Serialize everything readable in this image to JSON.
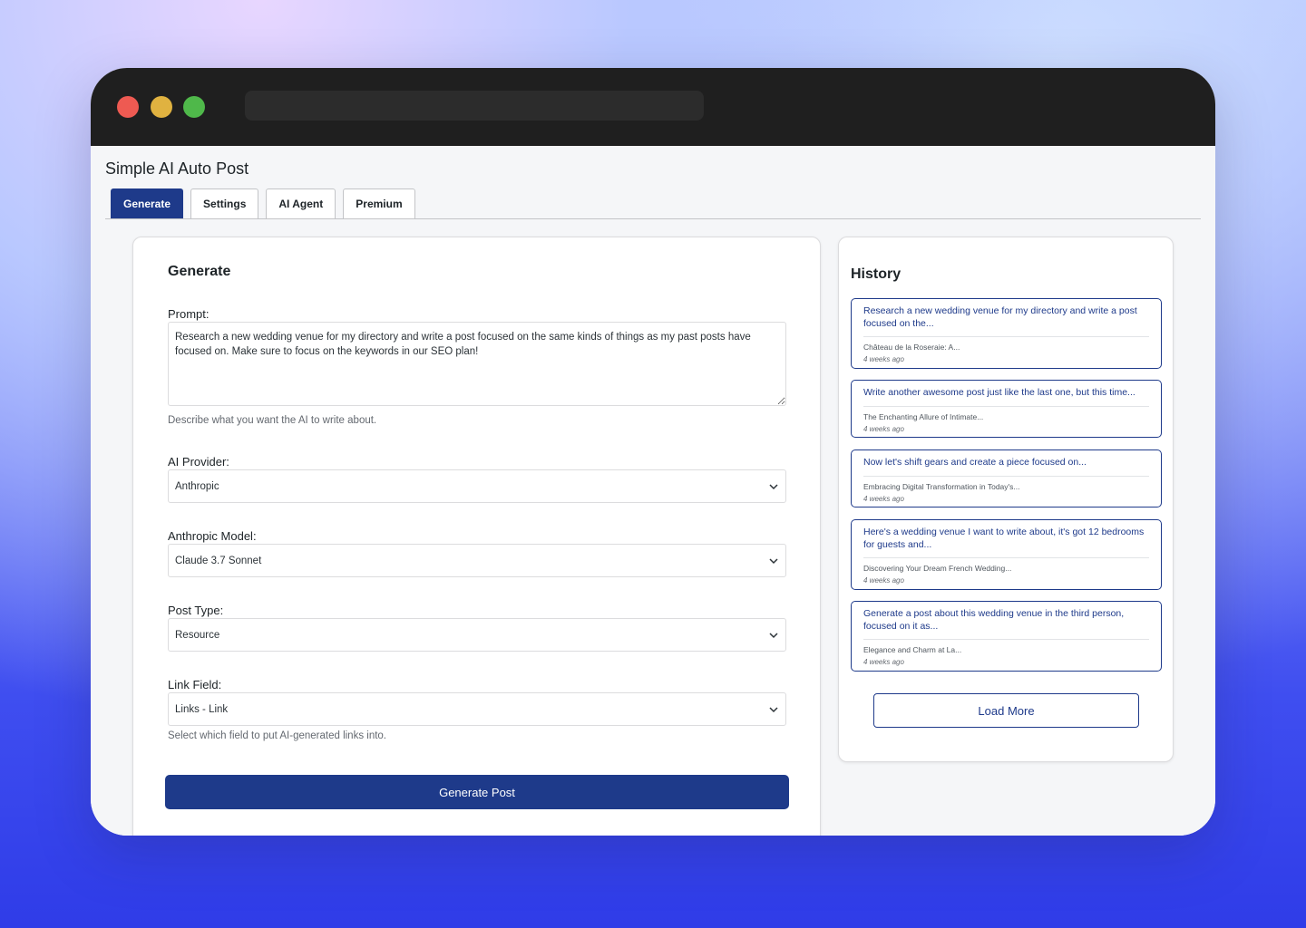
{
  "app": {
    "title": "Simple AI Auto Post"
  },
  "tabs": [
    "Generate",
    "Settings",
    "AI Agent",
    "Premium"
  ],
  "generate": {
    "heading": "Generate",
    "prompt_label": "Prompt:",
    "prompt_value": "Research a new wedding venue for my directory and write a post focused on the same kinds of things as my past posts have focused on. Make sure to focus on the keywords in our SEO plan!",
    "prompt_help": "Describe what you want the AI to write about.",
    "provider_label": "AI Provider:",
    "provider_value": "Anthropic",
    "model_label": "Anthropic Model:",
    "model_value": "Claude 3.7 Sonnet",
    "post_type_label": "Post Type:",
    "post_type_value": "Resource",
    "link_field_label": "Link Field:",
    "link_field_value": "Links - Link",
    "link_field_help": "Select which field to put AI-generated links into.",
    "button_label": "Generate Post"
  },
  "history": {
    "heading": "History",
    "items": [
      {
        "prompt": "Research a new wedding venue for my directory and write a post focused on the...",
        "title": "Château de la Roseraie: A...",
        "time": "4 weeks ago"
      },
      {
        "prompt": "Write another awesome post just like the last one, but this time...",
        "title": "The Enchanting Allure of Intimate...",
        "time": "4 weeks ago"
      },
      {
        "prompt": "Now let's shift gears and create a piece focused on...",
        "title": "Embracing Digital Transformation in Today's...",
        "time": "4 weeks ago"
      },
      {
        "prompt": "Here's a wedding venue I want to write about, it's got 12 bedrooms for guests and...",
        "title": "Discovering Your Dream French Wedding...",
        "time": "4 weeks ago"
      },
      {
        "prompt": "Generate a post about this wedding venue in the third person, focused on it as...",
        "title": "Elegance and Charm at La...",
        "time": "4 weeks ago"
      }
    ],
    "load_more_label": "Load More"
  },
  "colors": {
    "accent": "#1e3a8a",
    "titlebar": "#1f1f1f"
  }
}
